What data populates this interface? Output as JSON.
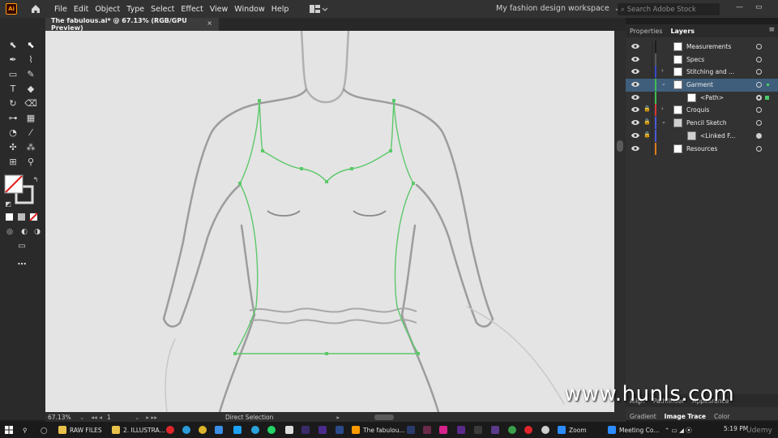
{
  "app": {
    "logo": "Ai",
    "menus": [
      "File",
      "Edit",
      "Object",
      "Type",
      "Select",
      "Effect",
      "View",
      "Window",
      "Help"
    ],
    "workspace": "My fashion design workspace",
    "search_placeholder": "Search Adobe Stock"
  },
  "document": {
    "tab_title": "The fabulous.ai* @ 67.13% (RGB/GPU Preview)",
    "close_glyph": "×"
  },
  "status": {
    "zoom": "67.13%",
    "page": "1",
    "tool": "Direct Selection"
  },
  "panel": {
    "tabs": [
      "Properties",
      "Layers"
    ],
    "active_tab": "Layers",
    "layers": [
      {
        "name": "Measurements",
        "color": "#1c1c1c",
        "expandable": false,
        "child": false,
        "locked": false,
        "selected": false
      },
      {
        "name": "Specs",
        "color": "#5a5a5a",
        "expandable": false,
        "child": false,
        "locked": false,
        "selected": false
      },
      {
        "name": "Stitching and ...",
        "color": "#3a48c8",
        "expandable": true,
        "child": false,
        "locked": false,
        "selected": false
      },
      {
        "name": "Garment",
        "color": "#3fbf55",
        "expandable": true,
        "child": false,
        "locked": false,
        "selected": true
      },
      {
        "name": "<Path>",
        "color": "#3fbf55",
        "expandable": false,
        "child": true,
        "locked": false,
        "selected": false
      },
      {
        "name": "Croquis",
        "color": "#d43a3a",
        "expandable": true,
        "child": false,
        "locked": true,
        "selected": false
      },
      {
        "name": "Pencil Sketch",
        "color": "#4a5ad8",
        "expandable": true,
        "child": false,
        "locked": true,
        "selected": false
      },
      {
        "name": "<Linked F...",
        "color": "#4a5ad8",
        "expandable": false,
        "child": true,
        "locked": true,
        "selected": false
      },
      {
        "name": "Resources",
        "color": "#e07a1a",
        "expandable": false,
        "child": false,
        "locked": false,
        "selected": false
      }
    ],
    "lower_tabs": [
      "Align",
      "Pathfinder",
      "Appearance"
    ],
    "lower_tabs2": [
      "Gradient",
      "Image Trace",
      "Color"
    ],
    "lower_active": "Image Trace"
  },
  "watermark": "www.hunls.com",
  "taskbar": {
    "items": [
      {
        "label": "RAW FILES",
        "color": "#e8c14a"
      },
      {
        "label": "2. ILLUSTRA...",
        "color": "#e8c14a"
      },
      {
        "label": "The fabulou...",
        "color": "#ff9a00"
      },
      {
        "label": "Zoom",
        "color": "#2d8cff"
      },
      {
        "label": "Meeting Co...",
        "color": "#2d8cff"
      }
    ],
    "time": "5:19 PM",
    "brand": "Udemy"
  }
}
